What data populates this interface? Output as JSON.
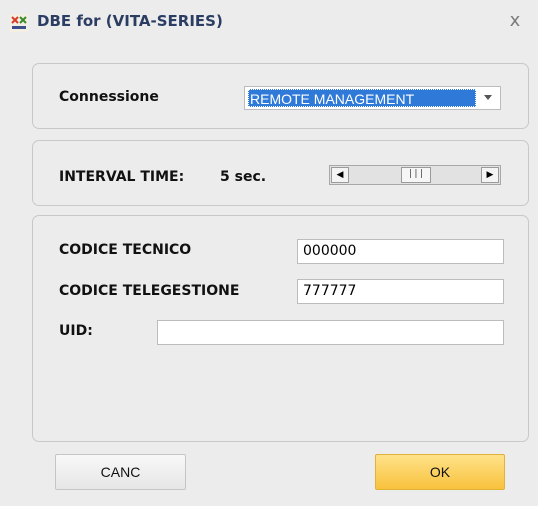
{
  "window": {
    "title": "DBE for (VITA-SERIES)",
    "close_glyph": "x",
    "icon": "app-logo-icon"
  },
  "connection": {
    "label": "Connessione",
    "selected": "REMOTE MANAGEMENT"
  },
  "interval": {
    "label": "INTERVAL TIME:",
    "value": "5 sec.",
    "scroll_left_glyph": "◀",
    "scroll_right_glyph": "▶",
    "thumb_glyph": "|||"
  },
  "codes": {
    "tecnico_label": "CODICE TECNICO",
    "tecnico_value": "000000",
    "telegestione_label": "CODICE TELEGESTIONE",
    "telegestione_value": "777777",
    "uid_label": "UID:",
    "uid_value": ""
  },
  "buttons": {
    "cancel": "CANC",
    "ok": "OK"
  },
  "colors": {
    "selection": "#2f7ad8",
    "ok_button": "#f8c23c",
    "title_text": "#2b3d63"
  }
}
